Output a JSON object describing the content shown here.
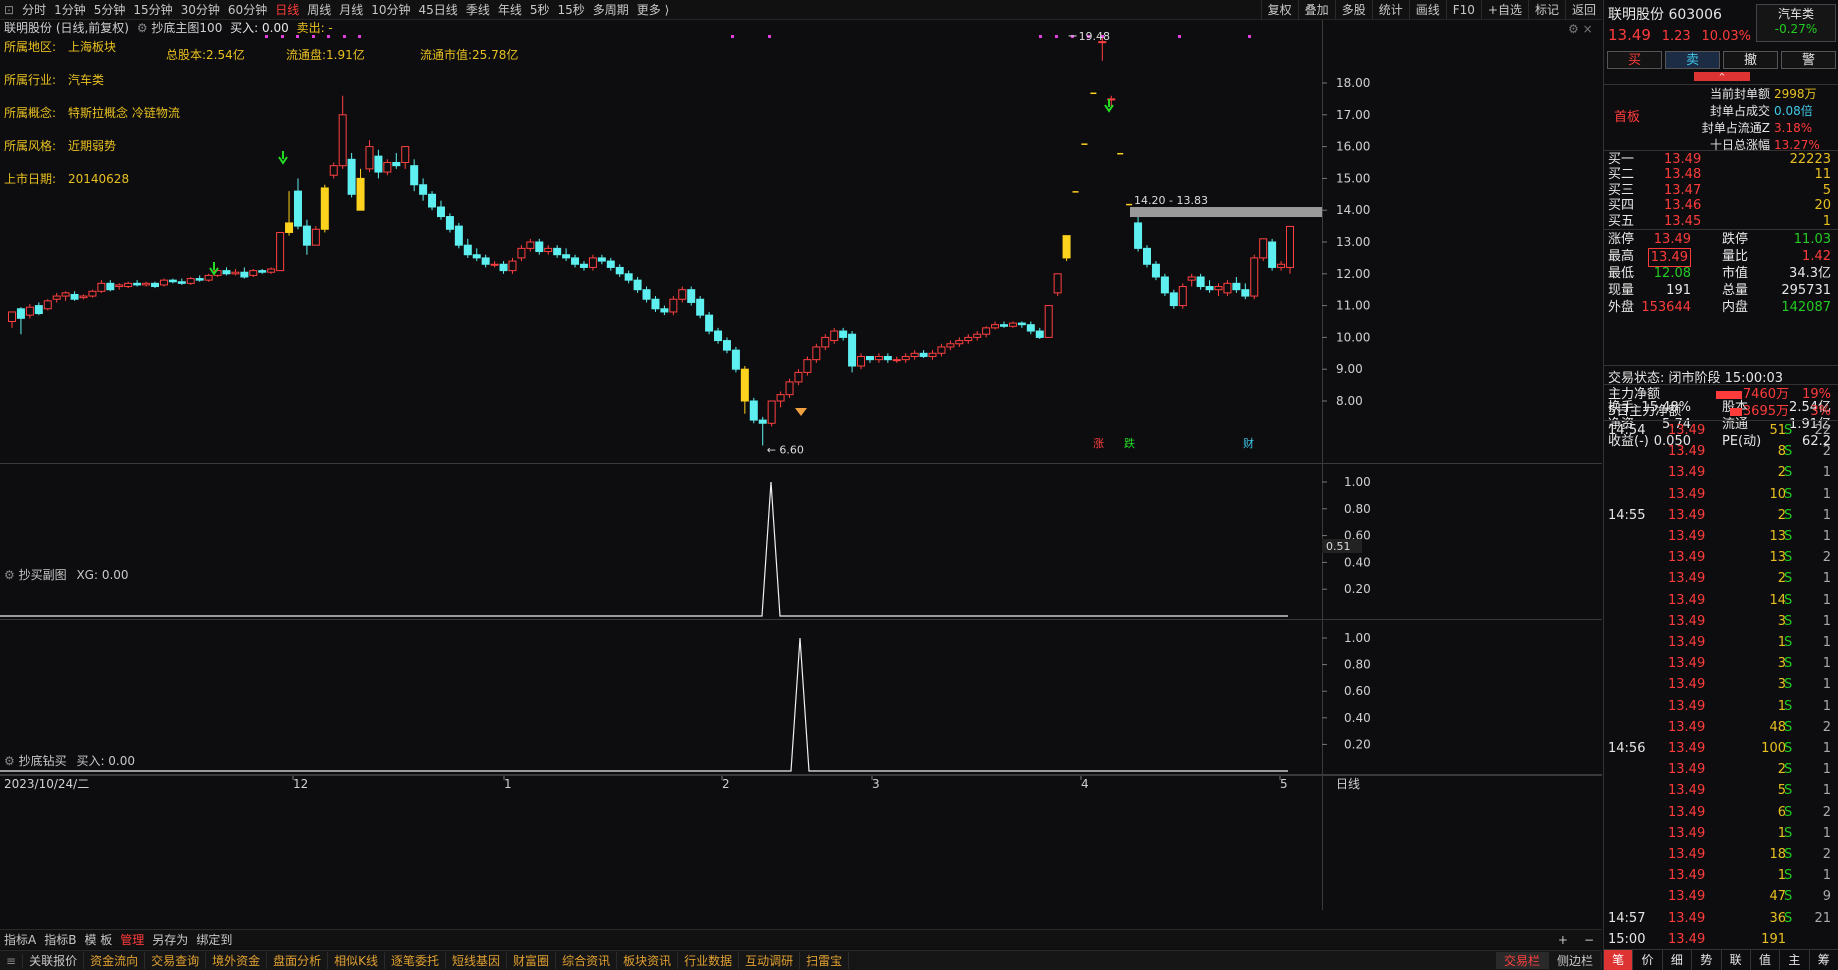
{
  "topbar": {
    "periods": [
      "分时",
      "1分钟",
      "5分钟",
      "15分钟",
      "30分钟",
      "60分钟",
      "日线",
      "周线",
      "月线",
      "10分钟",
      "45日线",
      "季线",
      "年线",
      "5秒",
      "15秒",
      "多周期",
      "更多 ⟩"
    ],
    "active": "日线",
    "tools": [
      "复权",
      "叠加",
      "多股",
      "统计",
      "画线",
      "F10",
      "+自选",
      "标记",
      "返回"
    ]
  },
  "chart_header": {
    "title": "联明股份 (日线,前复权)",
    "indicator": "抄底主图100",
    "buy_text": "买入: 0.00",
    "sell_text": "卖出: -"
  },
  "info": [
    {
      "label": "所属地区:",
      "value": "上海板块"
    },
    {
      "label": "所属行业:",
      "value": "汽车类"
    },
    {
      "label": "所属概念:",
      "value": "特斯拉概念 冷链物流"
    },
    {
      "label": "所属风格:",
      "value": "近期弱势"
    },
    {
      "label": "上市日期:",
      "value": "20140628"
    }
  ],
  "info_extra": [
    "总股本:2.54亿",
    "流通盘:1.91亿",
    "流通市值:25.78亿"
  ],
  "chart_data": {
    "type": "candlestick",
    "y_ticks": [
      "18.00",
      "17.00",
      "16.00",
      "15.00",
      "14.00",
      "13.00",
      "12.00",
      "11.00",
      "10.00",
      "9.00",
      "8.00"
    ],
    "x_labels": [
      "12",
      "1",
      "2",
      "3",
      "4",
      "5"
    ],
    "x_first": "2023/10/24/二",
    "high_label": "19.48",
    "low_label": "6.60",
    "range_label": "14.20 - 13.83",
    "event_marks": [
      "涨",
      "跌",
      "财"
    ],
    "period_label": "日线",
    "candles": [
      [
        10.5,
        10.8,
        10.3,
        10.8
      ],
      [
        10.9,
        10.6,
        10.1,
        10.95
      ],
      [
        10.7,
        10.95,
        10.6,
        11.05
      ],
      [
        11.0,
        10.75,
        10.7,
        11.1
      ],
      [
        10.9,
        11.15,
        10.85,
        11.2
      ],
      [
        11.2,
        11.3,
        11.1,
        11.4
      ],
      [
        11.3,
        11.4,
        11.15,
        11.45
      ],
      [
        11.35,
        11.2,
        11.15,
        11.45
      ],
      [
        11.25,
        11.3,
        11.2,
        11.35
      ],
      [
        11.3,
        11.45,
        11.25,
        11.5
      ],
      [
        11.45,
        11.7,
        11.4,
        11.8
      ],
      [
        11.7,
        11.5,
        11.45,
        11.8
      ],
      [
        11.6,
        11.65,
        11.5,
        11.7
      ],
      [
        11.6,
        11.7,
        11.55,
        11.75
      ],
      [
        11.7,
        11.65,
        11.6,
        11.8
      ],
      [
        11.65,
        11.7,
        11.6,
        11.75
      ],
      [
        11.7,
        11.6,
        11.55,
        11.75
      ],
      [
        11.65,
        11.8,
        11.6,
        11.85
      ],
      [
        11.8,
        11.75,
        11.7,
        11.85
      ],
      [
        11.75,
        11.7,
        11.65,
        11.85
      ],
      [
        11.7,
        11.85,
        11.65,
        11.9
      ],
      [
        11.85,
        11.8,
        11.75,
        11.95
      ],
      [
        11.8,
        11.95,
        11.75,
        12.0
      ],
      [
        11.95,
        12.1,
        11.9,
        12.2
      ],
      [
        12.1,
        12.0,
        11.95,
        12.2
      ],
      [
        12.0,
        12.05,
        11.95,
        12.15
      ],
      [
        12.05,
        11.9,
        11.85,
        12.2
      ],
      [
        11.95,
        12.1,
        11.9,
        12.15
      ],
      [
        12.1,
        12.05,
        12.0,
        12.15
      ],
      [
        12.05,
        12.15,
        12.0,
        12.2
      ],
      [
        12.1,
        13.3,
        12.1,
        13.3
      ],
      [
        13.3,
        13.6,
        13.2,
        14.6
      ],
      [
        14.6,
        13.5,
        13.4,
        15.0
      ],
      [
        13.5,
        12.9,
        12.6,
        13.7
      ],
      [
        12.9,
        13.4,
        12.9,
        13.5
      ],
      [
        13.4,
        14.7,
        13.3,
        14.8
      ],
      [
        15.1,
        15.4,
        15.0,
        15.5
      ],
      [
        15.4,
        17.0,
        15.3,
        17.6
      ],
      [
        15.6,
        14.5,
        14.4,
        15.8
      ],
      [
        14.0,
        15.0,
        14.0,
        15.3
      ],
      [
        15.3,
        16.0,
        15.2,
        16.2
      ],
      [
        15.7,
        15.2,
        15.0,
        15.9
      ],
      [
        15.2,
        15.5,
        15.1,
        15.6
      ],
      [
        15.5,
        15.4,
        15.3,
        15.8
      ],
      [
        15.5,
        16.0,
        15.3,
        16.0
      ],
      [
        15.4,
        14.8,
        14.6,
        15.6
      ],
      [
        14.8,
        14.5,
        14.3,
        15.0
      ],
      [
        14.5,
        14.1,
        14.0,
        14.6
      ],
      [
        14.1,
        13.8,
        13.7,
        14.3
      ],
      [
        13.8,
        13.4,
        13.3,
        13.9
      ],
      [
        13.5,
        12.9,
        12.8,
        13.6
      ],
      [
        12.9,
        12.6,
        12.5,
        13.1
      ],
      [
        12.6,
        12.5,
        12.4,
        12.8
      ],
      [
        12.5,
        12.3,
        12.2,
        12.6
      ],
      [
        12.3,
        12.3,
        12.2,
        12.4
      ],
      [
        12.3,
        12.1,
        12.0,
        12.4
      ],
      [
        12.1,
        12.4,
        12.0,
        12.5
      ],
      [
        12.5,
        12.8,
        12.4,
        12.9
      ],
      [
        12.8,
        13.0,
        12.7,
        13.1
      ],
      [
        13.0,
        12.7,
        12.6,
        13.1
      ],
      [
        12.7,
        12.8,
        12.6,
        12.9
      ],
      [
        12.8,
        12.6,
        12.5,
        12.9
      ],
      [
        12.6,
        12.5,
        12.4,
        12.8
      ],
      [
        12.5,
        12.3,
        12.2,
        12.6
      ],
      [
        12.3,
        12.2,
        12.1,
        12.4
      ],
      [
        12.2,
        12.5,
        12.1,
        12.6
      ],
      [
        12.5,
        12.4,
        12.3,
        12.6
      ],
      [
        12.4,
        12.2,
        12.1,
        12.5
      ],
      [
        12.2,
        12.0,
        11.9,
        12.3
      ],
      [
        12.0,
        11.8,
        11.7,
        12.1
      ],
      [
        11.8,
        11.5,
        11.4,
        11.9
      ],
      [
        11.5,
        11.2,
        11.1,
        11.6
      ],
      [
        11.2,
        10.9,
        10.8,
        11.3
      ],
      [
        10.9,
        10.8,
        10.7,
        11.0
      ],
      [
        10.8,
        11.2,
        10.7,
        11.3
      ],
      [
        11.2,
        11.5,
        11.1,
        11.6
      ],
      [
        11.5,
        11.1,
        11.0,
        11.6
      ],
      [
        11.2,
        10.7,
        10.6,
        11.3
      ],
      [
        10.7,
        10.2,
        10.1,
        10.8
      ],
      [
        10.2,
        9.9,
        9.8,
        10.3
      ],
      [
        9.9,
        9.6,
        9.5,
        10.0
      ],
      [
        9.6,
        9.0,
        8.9,
        9.7
      ],
      [
        9.0,
        8.0,
        7.6,
        9.1
      ],
      [
        8.0,
        7.4,
        7.3,
        8.1
      ],
      [
        7.4,
        7.3,
        6.6,
        7.5
      ],
      [
        7.3,
        8.0,
        7.2,
        8.0
      ],
      [
        8.0,
        8.2,
        7.8,
        8.3
      ],
      [
        8.2,
        8.6,
        8.1,
        8.7
      ],
      [
        8.6,
        8.9,
        8.5,
        9.0
      ],
      [
        8.9,
        9.3,
        8.8,
        9.4
      ],
      [
        9.3,
        9.7,
        9.2,
        9.8
      ],
      [
        9.7,
        10.0,
        9.6,
        10.1
      ],
      [
        9.9,
        10.2,
        9.8,
        10.3
      ],
      [
        10.2,
        10.0,
        9.9,
        10.3
      ],
      [
        10.1,
        9.1,
        8.9,
        10.2
      ],
      [
        9.1,
        9.4,
        9.0,
        9.5
      ],
      [
        9.4,
        9.3,
        9.2,
        9.4
      ],
      [
        9.3,
        9.4,
        9.2,
        9.5
      ],
      [
        9.4,
        9.3,
        9.2,
        9.5
      ],
      [
        9.3,
        9.3,
        9.2,
        9.4
      ],
      [
        9.3,
        9.4,
        9.2,
        9.5
      ],
      [
        9.4,
        9.5,
        9.3,
        9.6
      ],
      [
        9.5,
        9.4,
        9.35,
        9.6
      ],
      [
        9.4,
        9.5,
        9.3,
        9.6
      ],
      [
        9.5,
        9.7,
        9.4,
        9.8
      ],
      [
        9.7,
        9.8,
        9.6,
        9.9
      ],
      [
        9.8,
        9.9,
        9.7,
        10.0
      ],
      [
        9.9,
        10.0,
        9.8,
        10.1
      ],
      [
        10.0,
        10.1,
        9.9,
        10.2
      ],
      [
        10.1,
        10.3,
        10.0,
        10.35
      ],
      [
        10.3,
        10.4,
        10.25,
        10.5
      ],
      [
        10.4,
        10.35,
        10.3,
        10.5
      ],
      [
        10.35,
        10.45,
        10.3,
        10.5
      ],
      [
        10.45,
        10.4,
        10.3,
        10.5
      ],
      [
        10.4,
        10.2,
        10.1,
        10.5
      ],
      [
        10.2,
        10.0,
        9.95,
        10.3
      ],
      [
        10.0,
        11.0,
        10.0,
        11.0
      ],
      [
        11.4,
        12.0,
        11.3,
        12.0
      ],
      [
        12.5,
        13.2,
        12.4,
        13.2
      ],
      [
        14.6,
        14.6,
        14.6,
        14.6
      ],
      [
        16.1,
        16.1,
        16.1,
        16.1
      ],
      [
        17.7,
        17.7,
        17.7,
        17.7
      ],
      [
        19.3,
        19.3,
        18.7,
        19.48
      ],
      [
        17.5,
        17.5,
        17.2,
        17.6
      ],
      [
        15.8,
        15.8,
        15.8,
        15.8
      ],
      [
        14.2,
        14.2,
        14.2,
        14.2
      ],
      [
        13.6,
        12.8,
        12.7,
        13.9
      ],
      [
        12.8,
        12.3,
        12.2,
        12.9
      ],
      [
        12.3,
        11.9,
        11.8,
        12.4
      ],
      [
        11.9,
        11.4,
        11.3,
        12.0
      ],
      [
        11.4,
        11.0,
        10.9,
        11.5
      ],
      [
        11.0,
        11.6,
        10.9,
        11.7
      ],
      [
        11.8,
        11.9,
        11.6,
        12.0
      ],
      [
        11.9,
        11.6,
        11.5,
        12.0
      ],
      [
        11.6,
        11.5,
        11.4,
        11.8
      ],
      [
        11.5,
        11.6,
        11.3,
        11.7
      ],
      [
        11.4,
        11.7,
        11.3,
        11.8
      ],
      [
        11.7,
        11.5,
        11.4,
        11.9
      ],
      [
        11.5,
        11.3,
        11.2,
        11.7
      ],
      [
        11.3,
        12.5,
        11.2,
        12.6
      ],
      [
        12.5,
        13.1,
        12.4,
        13.1
      ],
      [
        13.0,
        12.2,
        12.1,
        13.1
      ],
      [
        12.2,
        12.3,
        12.1,
        12.4
      ],
      [
        12.2,
        13.49,
        12.0,
        13.49
      ]
    ],
    "signal_panel_1": {
      "title": "抄买副图",
      "value": "XG: 0.00",
      "y_ticks": [
        "1.00",
        "0.80",
        "0.60",
        "0.40",
        "0.20"
      ],
      "last_value": "0.51",
      "peak": 1.0
    },
    "signal_panel_2": {
      "title": "抄底钻买",
      "value": "买入: 0.00",
      "y_ticks": [
        "1.00",
        "0.80",
        "0.60",
        "0.40",
        "0.20"
      ],
      "peak": 1.0
    }
  },
  "bottom_tabs": [
    "指标A",
    "指标B",
    "模 板",
    "管理",
    "另存为",
    "绑定到"
  ],
  "bottom_tabs_active": "管理",
  "zoom_buttons": [
    "+",
    "−"
  ],
  "bottom_bar": [
    "关联报价",
    "资金流向",
    "交易查询",
    "境外资金",
    "盘面分析",
    "相似K线",
    "逐笔委托",
    "短线基因",
    "财富圈",
    "综合资讯",
    "板块资讯",
    "行业数据",
    "互动调研",
    "扫雷宝"
  ],
  "bottom_bar_right": [
    "交易栏",
    "侧边栏"
  ],
  "stock": {
    "name": "联明股份",
    "code": "603006",
    "sector": "汽车类",
    "sector_change": "-0.27%",
    "price": "13.49",
    "change": "1.23",
    "pct": "10.03%"
  },
  "trade_buttons": [
    "买",
    "卖",
    "撤",
    "警"
  ],
  "seal": {
    "tag": "首板",
    "rows": [
      [
        "当前封单额",
        "2998万"
      ],
      [
        "封单占成交",
        "0.08倍"
      ],
      [
        "封单占流通Z",
        "3.18%"
      ],
      [
        "十日总涨幅",
        "13.27%"
      ]
    ]
  },
  "orderbook": [
    [
      "买一",
      "13.49",
      "22223"
    ],
    [
      "买二",
      "13.48",
      "11"
    ],
    [
      "买三",
      "13.47",
      "5"
    ],
    [
      "买四",
      "13.46",
      "20"
    ],
    [
      "买五",
      "13.45",
      "1"
    ]
  ],
  "stats": [
    [
      "涨停",
      "13.49",
      "跌停",
      "11.03"
    ],
    [
      "最高",
      "13.49",
      "量比",
      "1.42"
    ],
    [
      "最低",
      "12.08",
      "市值",
      "34.3亿"
    ],
    [
      "现量",
      "191",
      "总量",
      "295731"
    ],
    [
      "外盘",
      "153644",
      "内盘",
      "142087"
    ],
    [
      "换手",
      "15.48%",
      "股本",
      "2.54亿"
    ],
    [
      "净资",
      "5.74",
      "流通",
      "1.91亿"
    ],
    [
      "收益(-)",
      "0.050",
      "PE(动)",
      "62.2"
    ]
  ],
  "trade_status": "交易状态: 闭市阶段 15:00:03",
  "mainflow": [
    [
      "主力净额",
      "7460万",
      "19%"
    ],
    [
      "5日主力净额",
      "3695万",
      "3%"
    ]
  ],
  "ticks": [
    [
      "14:54",
      "13.49",
      "51",
      "S",
      "22"
    ],
    [
      "",
      "13.49",
      "8",
      "S",
      "2"
    ],
    [
      "",
      "13.49",
      "2",
      "S",
      "1"
    ],
    [
      "",
      "13.49",
      "10",
      "S",
      "1"
    ],
    [
      "14:55",
      "13.49",
      "2",
      "S",
      "1"
    ],
    [
      "",
      "13.49",
      "13",
      "S",
      "1"
    ],
    [
      "",
      "13.49",
      "13",
      "S",
      "2"
    ],
    [
      "",
      "13.49",
      "2",
      "S",
      "1"
    ],
    [
      "",
      "13.49",
      "14",
      "S",
      "1"
    ],
    [
      "",
      "13.49",
      "3",
      "S",
      "1"
    ],
    [
      "",
      "13.49",
      "1",
      "S",
      "1"
    ],
    [
      "",
      "13.49",
      "3",
      "S",
      "1"
    ],
    [
      "",
      "13.49",
      "3",
      "S",
      "1"
    ],
    [
      "",
      "13.49",
      "1",
      "S",
      "1"
    ],
    [
      "",
      "13.49",
      "48",
      "S",
      "2"
    ],
    [
      "14:56",
      "13.49",
      "100",
      "S",
      "1"
    ],
    [
      "",
      "13.49",
      "2",
      "S",
      "1"
    ],
    [
      "",
      "13.49",
      "5",
      "S",
      "1"
    ],
    [
      "",
      "13.49",
      "6",
      "S",
      "2"
    ],
    [
      "",
      "13.49",
      "1",
      "S",
      "1"
    ],
    [
      "",
      "13.49",
      "18",
      "S",
      "2"
    ],
    [
      "",
      "13.49",
      "1",
      "S",
      "1"
    ],
    [
      "",
      "13.49",
      "47",
      "S",
      "9"
    ],
    [
      "14:57",
      "13.49",
      "36",
      "S",
      "21"
    ],
    [
      "15:00",
      "13.49",
      "191",
      "",
      ""
    ]
  ],
  "right_tabs": [
    "笔",
    "价",
    "细",
    "势",
    "联",
    "值",
    "主",
    "筹"
  ]
}
